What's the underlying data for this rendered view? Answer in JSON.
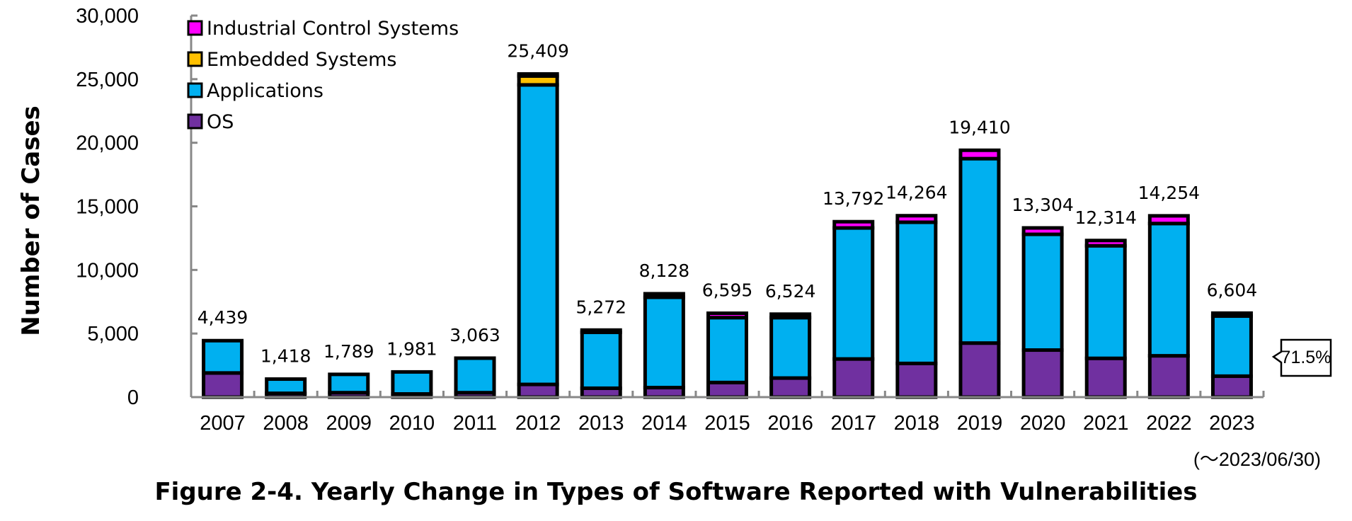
{
  "chart_data": {
    "type": "bar",
    "stacked": true,
    "title": "Figure 2-4. Yearly Change in Types of Software Reported with Vulnerabilities",
    "xlabel": "",
    "ylabel": "Number of Cases",
    "ylim": [
      0,
      30000
    ],
    "yticks": [
      0,
      5000,
      10000,
      15000,
      20000,
      25000,
      30000
    ],
    "ytick_labels": [
      "0",
      "5,000",
      "10,000",
      "15,000",
      "20,000",
      "25,000",
      "30,000"
    ],
    "grid": false,
    "legend_position": "top-left",
    "categories": [
      "2007",
      "2008",
      "2009",
      "2010",
      "2011",
      "2012",
      "2013",
      "2014",
      "2015",
      "2016",
      "2017",
      "2018",
      "2019",
      "2020",
      "2021",
      "2022",
      "2023"
    ],
    "series": [
      {
        "name": "OS",
        "color": "#7030A0",
        "values": [
          1900,
          300,
          350,
          250,
          350,
          1000,
          700,
          750,
          1150,
          1500,
          3000,
          2650,
          4250,
          3700,
          3050,
          3250,
          1650
        ]
      },
      {
        "name": "Applications",
        "color": "#00B0F0",
        "values": [
          2539,
          1118,
          1439,
          1731,
          2713,
          23550,
          4400,
          7100,
          5100,
          4750,
          10300,
          11100,
          14500,
          9100,
          8850,
          10400,
          4722
        ]
      },
      {
        "name": "Embedded Systems",
        "color": "#FFC000",
        "values": [
          0,
          0,
          0,
          0,
          0,
          700,
          0,
          0,
          0,
          0,
          0,
          0,
          0,
          0,
          0,
          0,
          0
        ]
      },
      {
        "name": "Industrial Control Systems",
        "color": "#FF00FF",
        "values": [
          0,
          0,
          0,
          0,
          0,
          159,
          172,
          278,
          345,
          274,
          492,
          514,
          660,
          504,
          414,
          604,
          232
        ]
      }
    ],
    "totals": [
      4439,
      1418,
      1789,
      1981,
      3063,
      25409,
      5272,
      8128,
      6595,
      6524,
      13792,
      14264,
      19410,
      13304,
      12314,
      14254,
      6604
    ],
    "total_labels": [
      "4,439",
      "1,418",
      "1,789",
      "1,981",
      "3,063",
      "25,409",
      "5,272",
      "8,128",
      "6,595",
      "6,524",
      "13,792",
      "14,264",
      "19,410",
      "13,304",
      "12,314",
      "14,254",
      "6,604"
    ],
    "legend": [
      "Industrial Control Systems",
      "Embedded Systems",
      "Applications",
      "OS"
    ],
    "annotations": [
      {
        "text": "71.5%",
        "target": "2023 Applications share"
      },
      {
        "text": "(～2023/06/30)",
        "target": "2023 period note"
      }
    ]
  }
}
